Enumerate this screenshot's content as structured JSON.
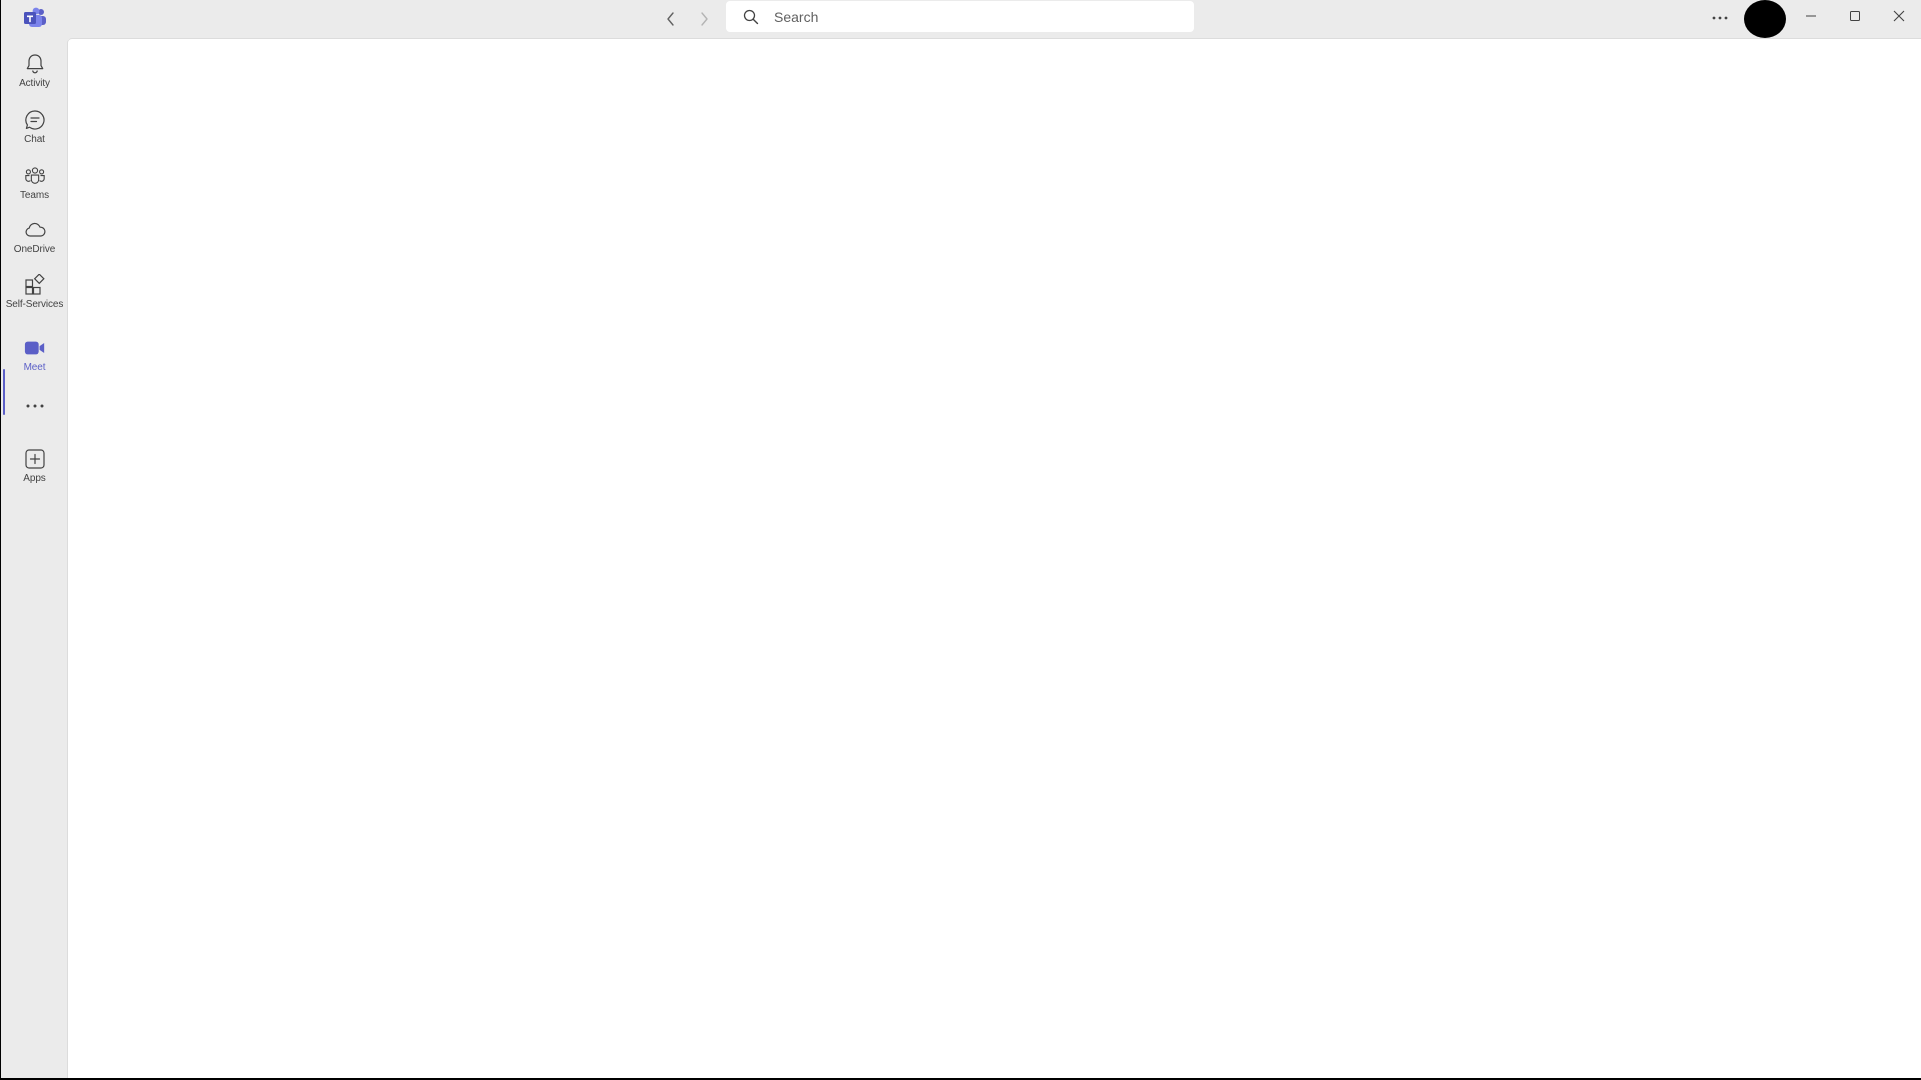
{
  "titlebar": {
    "search": {
      "placeholder": "Search",
      "value": ""
    }
  },
  "rail": {
    "items": [
      {
        "label": "Activity",
        "icon": "bell-icon"
      },
      {
        "label": "Chat",
        "icon": "chat-icon"
      },
      {
        "label": "Teams",
        "icon": "teams-icon"
      },
      {
        "label": "OneDrive",
        "icon": "cloud-icon"
      },
      {
        "label": "Self-Services",
        "icon": "apps-grid-icon"
      },
      {
        "label": "Meet",
        "icon": "video-camera-icon",
        "active": true
      },
      {
        "label": "",
        "icon": "more-apps-icon"
      },
      {
        "label": "Apps",
        "icon": "add-app-icon"
      }
    ]
  },
  "colors": {
    "accent": "#5b5fc7",
    "titlebar_bg": "#ebebeb",
    "content_bg": "#ffffff"
  }
}
